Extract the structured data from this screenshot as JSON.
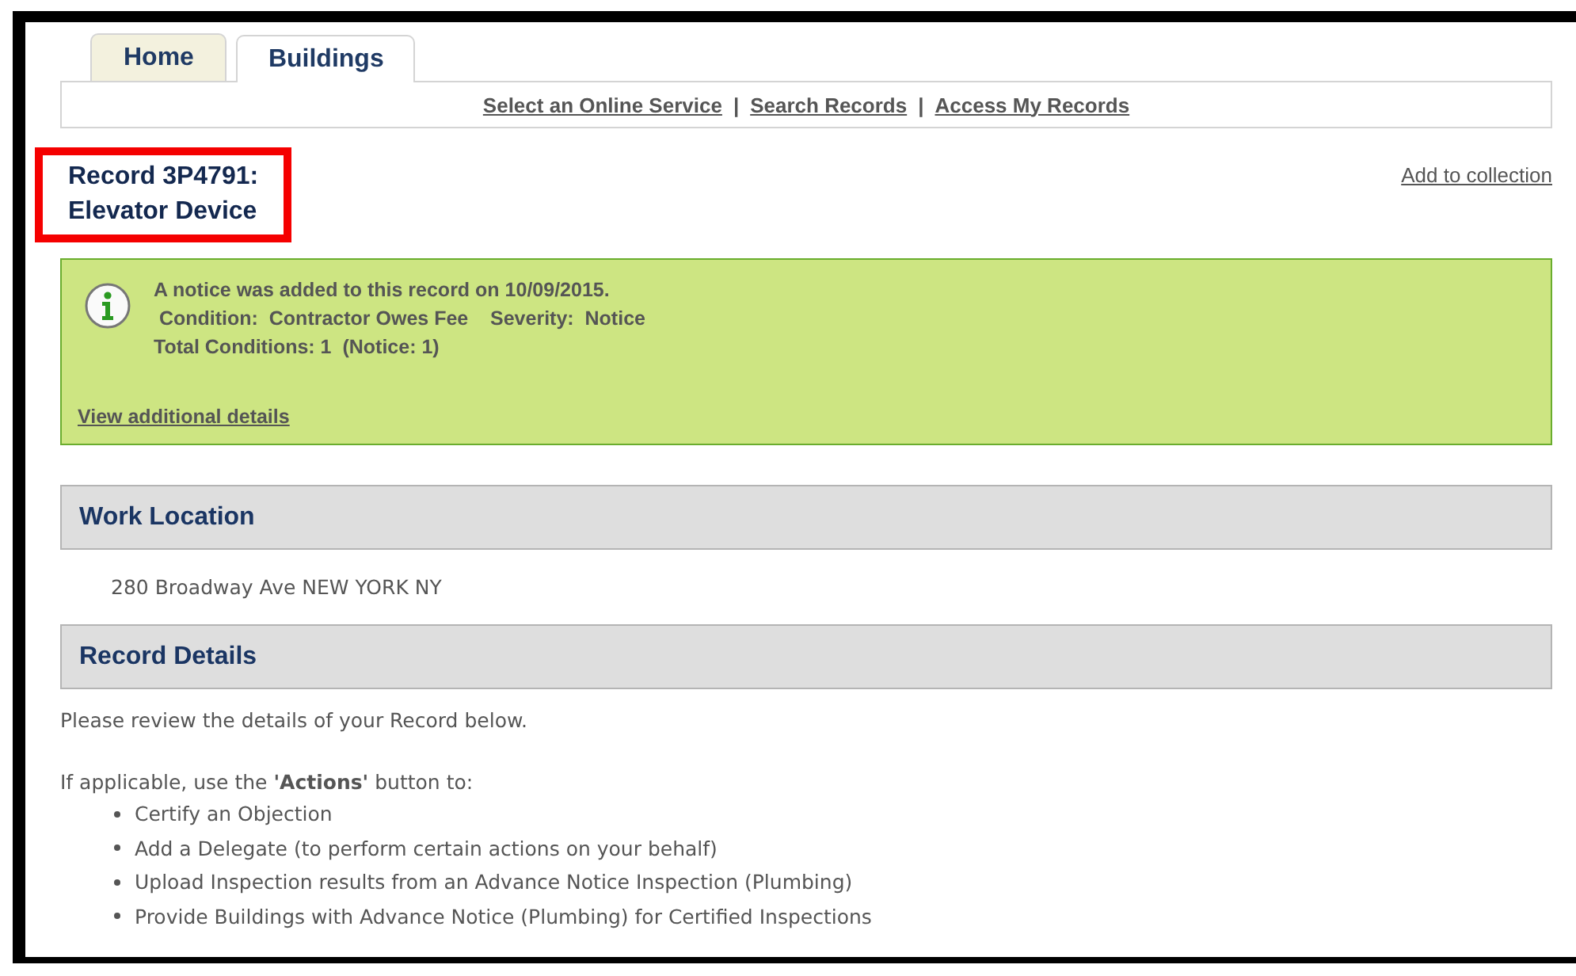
{
  "tabs": [
    {
      "label": "Home",
      "selected": false
    },
    {
      "label": "Buildings",
      "selected": true
    }
  ],
  "nav_items": [
    {
      "kind": "link",
      "text": "Select an Online Service"
    },
    {
      "kind": "separator",
      "text": "|"
    },
    {
      "kind": "link",
      "text": "Search Records"
    },
    {
      "kind": "separator",
      "text": "|"
    },
    {
      "kind": "link",
      "text": "Access My Records"
    }
  ],
  "record_title": {
    "lines": [
      "Record 3P4791:",
      "Elevator Device"
    ],
    "highlighted": true
  },
  "add_to_collection": "Add to collection",
  "notice": {
    "lines": [
      "A notice was added to this record on 10/09/2015.",
      " Condition:  Contractor Owes Fee    Severity:  Notice",
      "Total Conditions: 1  (Notice: 1)"
    ],
    "link": "View additional details"
  },
  "sections": [
    {
      "title": "Work Location",
      "body": [
        "280 Broadway Ave NEW YORK NY"
      ]
    },
    {
      "title": "Record Details",
      "intro": "Please review the details of your Record below.",
      "lead": "If applicable, use the **'Actions'** button to:",
      "bullets": [
        "Certify an Objection",
        "Add a Delegate (to perform certain actions on your behalf)",
        "Upload Inspection results from an Advance Notice Inspection (Plumbing)",
        "Provide Buildings with Advance Notice (Plumbing) for Certified Inspections"
      ]
    }
  ]
}
